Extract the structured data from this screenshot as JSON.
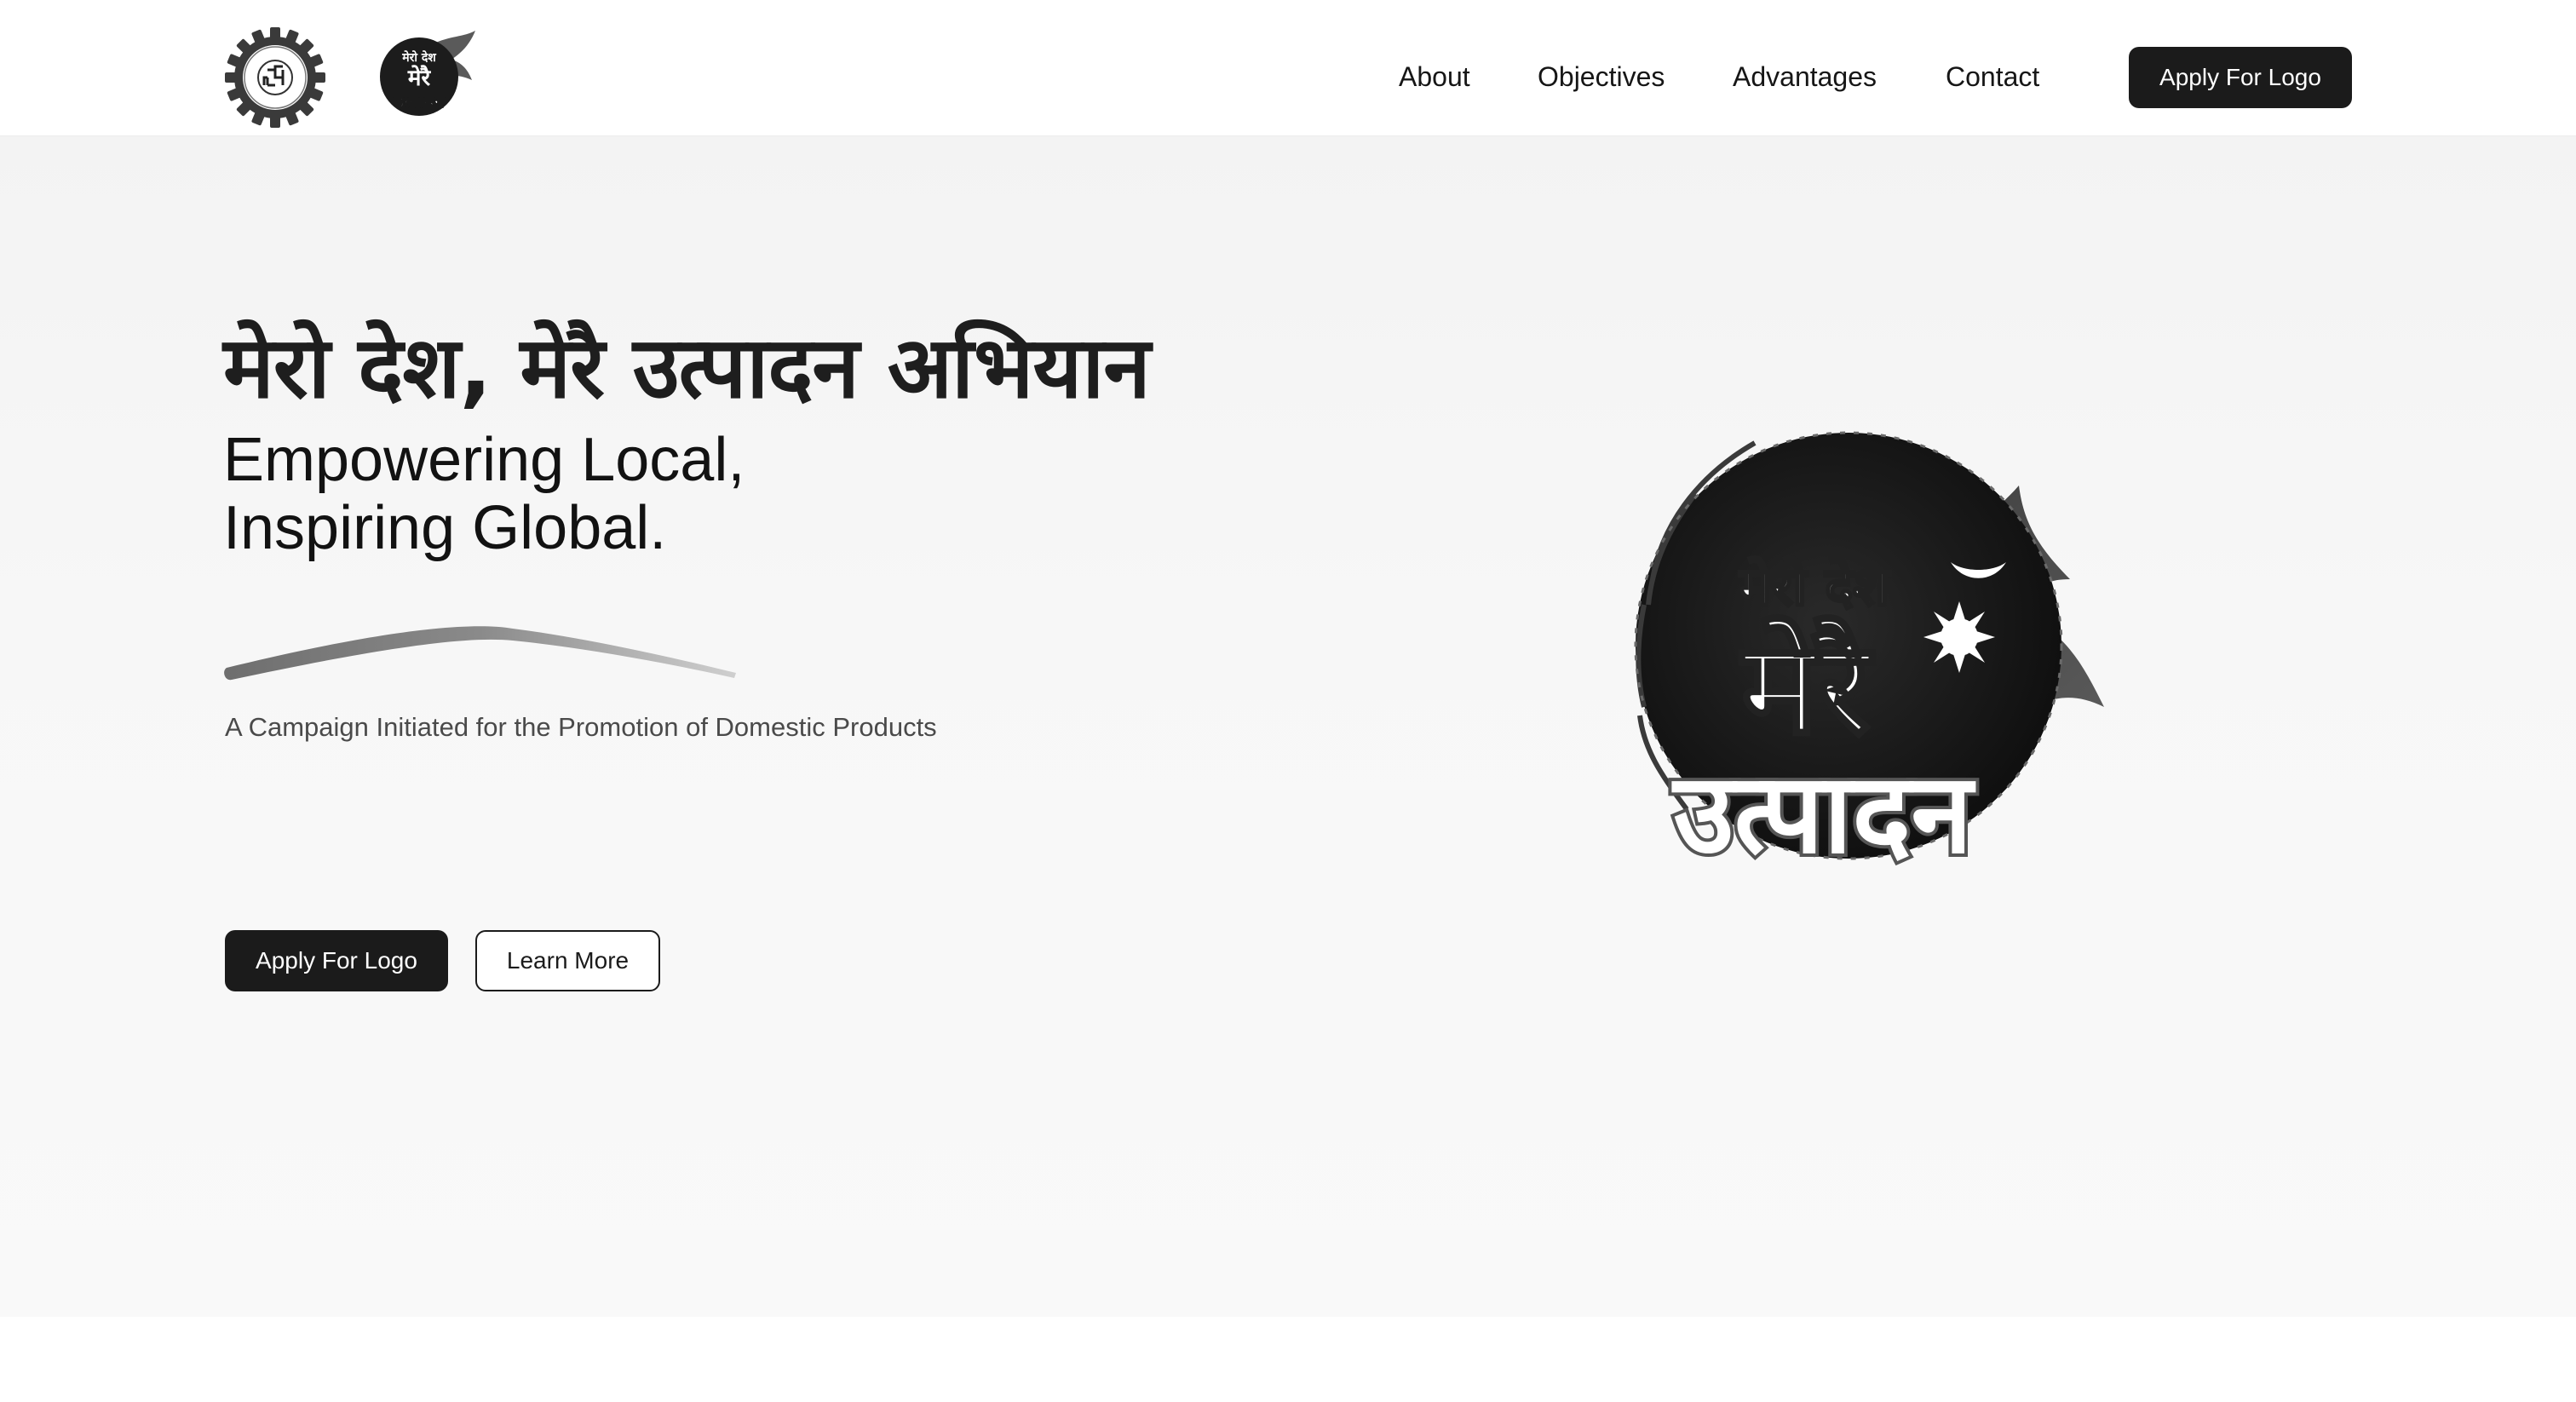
{
  "header": {
    "gear_logo_icon": "gear-emblem-icon",
    "campaign_logo_icon": "mero-desh-merai-utpadan-logo-icon",
    "nav": [
      {
        "label": "About"
      },
      {
        "label": "Objectives"
      },
      {
        "label": "Advantages"
      },
      {
        "label": "Contact"
      }
    ],
    "cta_label": "Apply For Logo"
  },
  "hero": {
    "title_np": "मेरो देश, मेरै उत्पादन अभियान",
    "title_en_line1": "Empowering Local,",
    "title_en_line2": "Inspiring Global.",
    "subtitle": "A Campaign Initiated for the Promotion of Domestic Products",
    "primary_button": "Apply For Logo",
    "secondary_button": "Learn More",
    "logo_text_top": "मेरो देश",
    "logo_text_mid": "मेरै",
    "logo_text_bottom": "उत्पादन"
  },
  "colors": {
    "dark": "#1b1b1b",
    "hero_bg": "#f5f5f5",
    "text_muted": "#4a4a4a"
  }
}
